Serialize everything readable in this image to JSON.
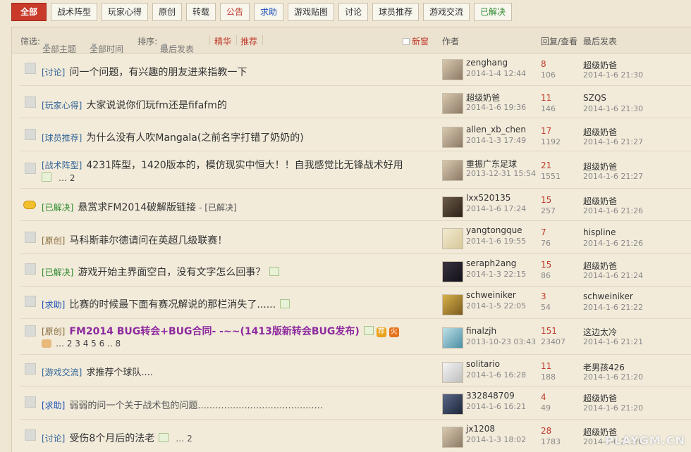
{
  "tabs": [
    {
      "label": "全部",
      "active": true
    },
    {
      "label": "战术阵型"
    },
    {
      "label": "玩家心得"
    },
    {
      "label": "原创"
    },
    {
      "label": "转载"
    },
    {
      "label": "公告",
      "color": "#c0392b"
    },
    {
      "label": "求助",
      "color": "#1a4fb5"
    },
    {
      "label": "游戏贴图"
    },
    {
      "label": "讨论"
    },
    {
      "label": "球员推荐"
    },
    {
      "label": "游戏交流"
    },
    {
      "label": "已解决",
      "color": "#2e8b2e"
    }
  ],
  "header": {
    "filter_label": "筛选:",
    "filter_topics": "全部主题",
    "filter_time": "全部时间",
    "sort_label": "排序:",
    "sort_value": "最后发表",
    "jinghua": "精华",
    "tuijian": "推荐",
    "new_window": "新窗",
    "col_author": "作者",
    "col_reply_view": "回复/查看",
    "col_last": "最后发表"
  },
  "threads": [
    {
      "category": "[讨论]",
      "title": "问一个问题，有兴趣的朋友进来指教一下",
      "author": "zenghang",
      "date": "2014-1-4 12:44",
      "replies": "8",
      "views": "106",
      "last_user": "超级奶爸",
      "last_time": "2014-1-6 21:30"
    },
    {
      "category": "[玩家心得]",
      "title": "大家说说你们玩fm还是fifafm的",
      "author": "超级奶爸",
      "date": "2014-1-6 19:36",
      "replies": "11",
      "views": "146",
      "last_user": "SZQS",
      "last_time": "2014-1-6 21:30"
    },
    {
      "category": "[球员推荐]",
      "title": "为什么没有人吹Mangala(之前名字打错了奶奶的)",
      "author": "allen_xb_chen",
      "date": "2014-1-3 17:49",
      "replies": "17",
      "views": "1192",
      "last_user": "超级奶爸",
      "last_time": "2014-1-6 21:27"
    },
    {
      "category": "[战术阵型]",
      "title": "4231阵型，1420版本的，模仿现实中恒大！！自我感觉比无锋战术好用",
      "pages": "… 2",
      "author": "重振广东足球",
      "date": "2013-12-31 15:54",
      "replies": "21",
      "views": "1551",
      "last_user": "超级奶爸",
      "last_time": "2014-1-6 21:27"
    },
    {
      "category": "[已解决]",
      "title": "悬赏求FM2014破解版链接",
      "suffix": "- [已解决]",
      "author": "lxx520135",
      "date": "2014-1-6 17:24",
      "replies": "15",
      "views": "257",
      "last_user": "超级奶爸",
      "last_time": "2014-1-6 21:26"
    },
    {
      "category": "[原创]",
      "title": "马科斯菲尔德请问在英超几级联赛！",
      "author": "yangtongque",
      "date": "2014-1-6 19:55",
      "replies": "7",
      "views": "76",
      "last_user": "hispline",
      "last_time": "2014-1-6 21:26"
    },
    {
      "category": "[已解决]",
      "title": "游戏开始主界面空白，没有文字怎么回事？",
      "author": "seraph2ang",
      "date": "2014-1-3 22:15",
      "replies": "15",
      "views": "86",
      "last_user": "超级奶爸",
      "last_time": "2014-1-6 21:24"
    },
    {
      "category": "[求助]",
      "title": "比赛的时候最下面有赛况解说的那栏消失了......",
      "author": "schweiniker",
      "date": "2014-1-5 22:05",
      "replies": "3",
      "views": "54",
      "last_user": "schweiniker",
      "last_time": "2014-1-6 21:22"
    },
    {
      "category": "[原创]",
      "title": "FM2014 BUG转会+BUG合同- -~~(1413版新转会BUG发布)",
      "badge1": "荐",
      "badge2": "火",
      "pages": "… 2 3 4 5 6 .. 8",
      "author": "finalzjh",
      "date": "2013-10-23 03:43",
      "replies": "151",
      "views": "23407",
      "last_user": "这边太冷",
      "last_time": "2014-1-6 21:21"
    },
    {
      "category": "[游戏交流]",
      "title": "求推荐个球队....",
      "author": "solitario",
      "date": "2014-1-6 16:28",
      "replies": "11",
      "views": "188",
      "last_user": "老男孩426",
      "last_time": "2014-1-6 21:20"
    },
    {
      "category": "[求助]",
      "title": "弱弱的问一个关于战术包的问题...........................................",
      "author": "332848709",
      "date": "2014-1-6 16:21",
      "replies": "4",
      "views": "49",
      "last_user": "超级奶爸",
      "last_time": "2014-1-6 21:20"
    },
    {
      "category": "[讨论]",
      "title": "受伤8个月后的法老",
      "pages": "… 2",
      "author": "jx1208",
      "date": "2014-1-3 18:02",
      "replies": "28",
      "views": "1783",
      "last_user": "超级奶爸",
      "last_time": "2014-1-6 21:20"
    }
  ],
  "watermark": "PLAYGM.CN"
}
